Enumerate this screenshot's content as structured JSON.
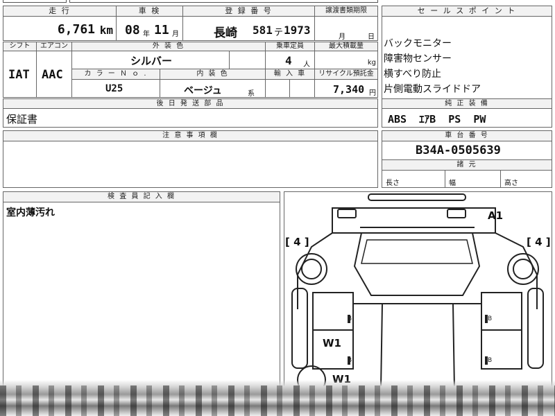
{
  "header": {
    "mileage_label": "走 行",
    "inspection_label": "車 検",
    "registration_label": "登 録 番 号",
    "transfer_label": "譲渡書類期限",
    "sales_points_label": "セ ー ル ス ポ イ ン ト"
  },
  "vehicle": {
    "mileage_value": "6,761",
    "mileage_unit": "km",
    "inspection_year": "08",
    "inspection_year_unit": "年",
    "inspection_month": "11",
    "inspection_month_unit": "月",
    "registration_place": "長崎",
    "registration_class": "581",
    "registration_kana": "テ",
    "registration_number": "1973",
    "transfer_month_unit": "月",
    "transfer_day_unit": "日"
  },
  "row2": {
    "shift_label": "シフト",
    "aircon_label": "エアコン",
    "exterior_label": "外 装 色",
    "capacity_label": "乗車定員",
    "load_label": "最大積載量",
    "shift_value": "IAT",
    "aircon_value": "AAC",
    "exterior_value": "シルバー",
    "capacity_value": "4",
    "capacity_unit": "人",
    "load_unit": "kg",
    "color_no_label": "カ ラ ー Ｎ ｏ .",
    "interior_label": "内 装 色",
    "import_label": "輸 入 車",
    "recycle_label": "リサイクル預託金",
    "color_no_value": "U25",
    "interior_value": "ベージュ",
    "interior_suffix": "系",
    "recycle_value": "7,340",
    "recycle_unit": "円"
  },
  "sales_points": [
    "バックモニター",
    "障害物センサー",
    "横すべり防止",
    "片側電動スライドドア"
  ],
  "later_parts": {
    "label": "後 日 発 送 部 品",
    "value": "保証書"
  },
  "genuine_equipment": {
    "label": "純 正 装 備",
    "value": "ABS  ｴｱB  PS  PW"
  },
  "notes": {
    "label": "注 意 事 項 欄",
    "value": ""
  },
  "chassis": {
    "label": "車 台 番 号",
    "value": "B34A-0505639"
  },
  "dimensions": {
    "label": "諸 元",
    "length": "長さ",
    "width": "幅",
    "height": "高さ"
  },
  "inspector": {
    "label": "検 査 員 記 入 欄",
    "value": "室内薄汚れ"
  },
  "diagram": {
    "marks": {
      "front_right": "A1",
      "left_wheel": "[ 4 ]",
      "right_wheel": "[ 4 ]",
      "left_door": "W1",
      "left_lower": "W1"
    },
    "door_letter": "B"
  }
}
